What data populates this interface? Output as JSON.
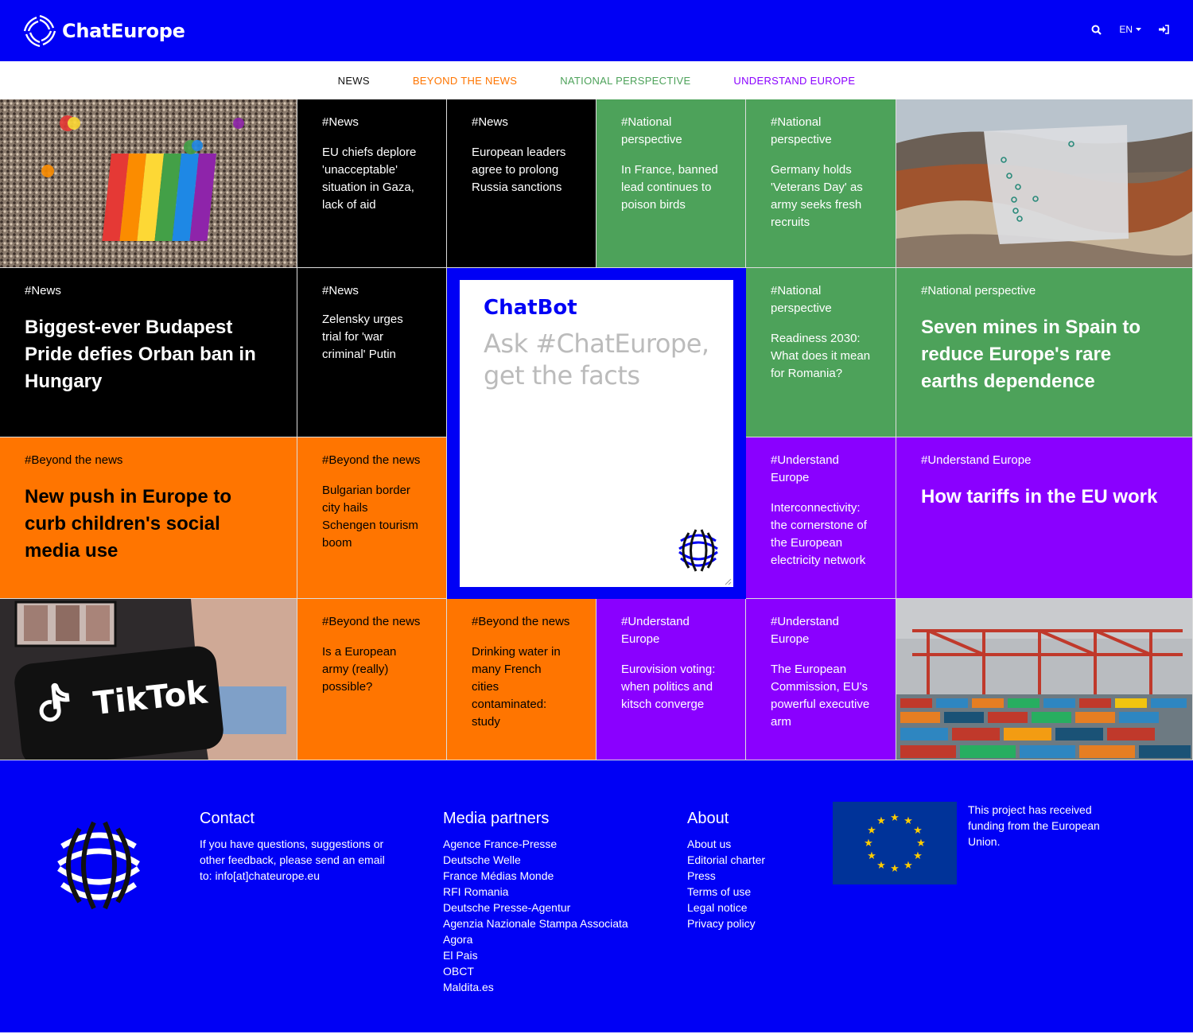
{
  "header": {
    "brand": "ChatEurope",
    "lang": "EN"
  },
  "nav": [
    {
      "label": "NEWS",
      "color": "#111111"
    },
    {
      "label": "BEYOND THE NEWS",
      "color": "#ff7500"
    },
    {
      "label": "NATIONAL PERSPECTIVE",
      "color": "#4da25a"
    },
    {
      "label": "UNDERSTAND EUROPE",
      "color": "#8a00ff"
    }
  ],
  "tiles": {
    "t1": {
      "tag": "#News",
      "title": "EU chiefs deplore 'unacceptable' situation in Gaza, lack of aid"
    },
    "t2": {
      "tag": "#News",
      "title": "European leaders agree to prolong Russia sanctions"
    },
    "t3": {
      "tag": "#National perspective",
      "title": "In France, banned lead continues to poison birds"
    },
    "t4": {
      "tag": "#National perspective",
      "title": "Germany holds 'Veterans Day' as army seeks fresh recruits"
    },
    "t5": {
      "tag": "#News",
      "title": "Biggest-ever Budapest Pride defies Orban ban in Hungary"
    },
    "t6": {
      "tag": "#News",
      "title": "Zelensky urges trial for 'war criminal' Putin"
    },
    "t7": {
      "tag": "#National perspective",
      "title": "Readiness 2030: What does it mean for Romania?"
    },
    "t8": {
      "tag": "#National perspective",
      "title": "Seven mines in Spain to reduce Europe's rare earths dependence"
    },
    "t9": {
      "tag": "#Beyond the news",
      "title": "New push in Europe to curb children's social media use"
    },
    "t10": {
      "tag": "#Beyond the news",
      "title": "Bulgarian border city hails Schengen tourism boom"
    },
    "t11": {
      "tag": "#Understand Europe",
      "title": "Interconnectivity: the cornerstone of the European electricity network"
    },
    "t12": {
      "tag": "#Understand Europe",
      "title": "How tariffs in the EU work"
    },
    "t13": {
      "tag": "#Beyond the news",
      "title": "Is a European army (really) possible?"
    },
    "t14": {
      "tag": "#Beyond the news",
      "title": "Drinking water in many French cities contaminated: study"
    },
    "t15": {
      "tag": "#Understand Europe",
      "title": "Eurovision voting: when politics and kitsch converge"
    },
    "t16": {
      "tag": "#Understand Europe",
      "title": "The European Commission, EU's powerful executive arm"
    }
  },
  "chatbot": {
    "title": "ChatBot",
    "placeholder": "Ask #ChatEurope, get the facts"
  },
  "images": {
    "tiktok_text": "TikTok"
  },
  "footer": {
    "contact": {
      "heading": "Contact",
      "text": "If you have questions, suggestions or other feedback, please send an email to: info[at]chateurope.eu"
    },
    "partners": {
      "heading": "Media partners",
      "links": [
        "Agence France-Presse",
        "Deutsche Welle",
        "France Médias Monde",
        "RFI Romania",
        "Deutsche Presse-Agentur",
        "Agenzia Nazionale Stampa Associata",
        "Agora",
        "El Pais",
        "OBCT",
        "Maldita.es"
      ]
    },
    "about": {
      "heading": "About",
      "links": [
        "About us",
        "Editorial charter",
        "Press",
        "Terms of use",
        "Legal notice",
        "Privacy policy"
      ]
    },
    "funding": "This project has received funding from the European Union."
  }
}
